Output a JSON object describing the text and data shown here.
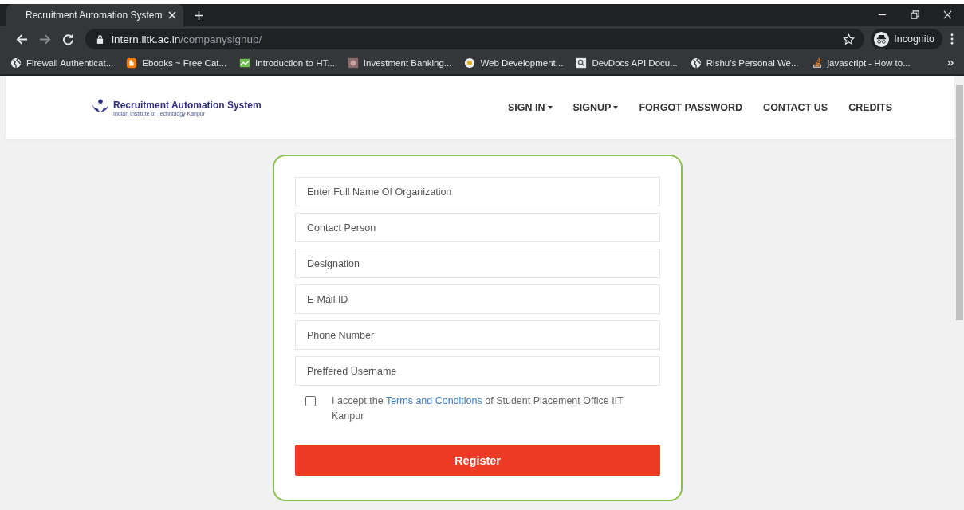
{
  "browser": {
    "tab": {
      "title": "Recruitment Automation System"
    },
    "url": {
      "host": "intern.iitk.ac.in",
      "path": "/companysignup/"
    },
    "profile": "Incognito",
    "bookmarks": [
      {
        "kind": "globe",
        "label": "Firewall Authenticat..."
      },
      {
        "kind": "blog",
        "label": "Ebooks ~ Free Cat..."
      },
      {
        "kind": "chart",
        "label": "Introduction to HT..."
      },
      {
        "kind": "image",
        "label": "Investment Banking..."
      },
      {
        "kind": "coin",
        "label": "Web Development..."
      },
      {
        "kind": "search",
        "label": "DevDocs API Docu..."
      },
      {
        "kind": "globe",
        "label": "Rishu's Personal We..."
      },
      {
        "kind": "stack",
        "label": "javascript - How to..."
      }
    ]
  },
  "header": {
    "logo": {
      "title": "Recruitment Automation System",
      "subtitle": "Indian Institute of Technology Kanpur"
    },
    "nav": [
      {
        "label": "SIGN IN",
        "dropdown": true
      },
      {
        "label": "SIGNUP",
        "dropdown": true
      },
      {
        "label": "FORGOT PASSWORD",
        "dropdown": false
      },
      {
        "label": "CONTACT US",
        "dropdown": false
      },
      {
        "label": "CREDITS",
        "dropdown": false
      }
    ]
  },
  "form": {
    "fields": [
      {
        "placeholder": "Enter Full Name Of Organization"
      },
      {
        "placeholder": "Contact Person"
      },
      {
        "placeholder": "Designation"
      },
      {
        "placeholder": "E-Mail ID"
      },
      {
        "placeholder": "Phone Number"
      },
      {
        "placeholder": "Preffered Username"
      }
    ],
    "terms": {
      "checked": false,
      "before": "I accept the ",
      "link": "Terms and Conditions",
      "after": " of Student Placement Office IIT Kanpur"
    },
    "button": "Register"
  }
}
